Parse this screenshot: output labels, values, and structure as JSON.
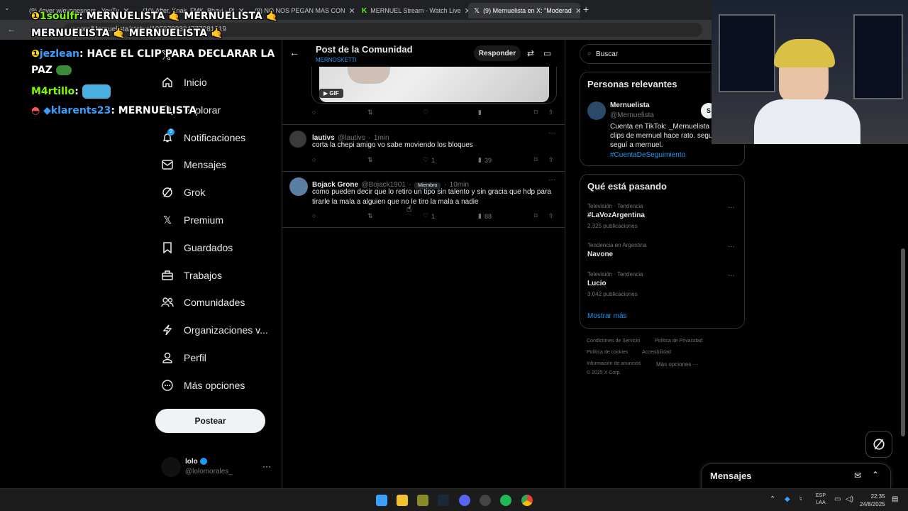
{
  "browser": {
    "tabs": [
      {
        "label": "(9) 4ever w/evanesnom - YouTu",
        "color": "#ff0000"
      },
      {
        "label": "(10) After, Knak, FMK, Bhavi - Pl",
        "color": "#ff0000"
      },
      {
        "label": "(9) NO NOS PEGAN MAS CON",
        "color": "#ff0000"
      },
      {
        "label": "MERNUEL Stream - Watch Live",
        "color": "#53fc18"
      },
      {
        "label": "(9) Mernuelista en X: \"Moderad",
        "color": "#ffffff"
      }
    ],
    "url": "x.com/Mernuelista/status/1959788384777281819"
  },
  "chat": [
    {
      "user": "1soulfr",
      "msg": ": MERNUELISTA",
      "msg2": "MERNUELISTA",
      "user_color": "#7cfc00"
    },
    {
      "user": "",
      "msg": "MERNUELISTA",
      "msg2": "MERNUELISTA",
      "user_color": "#ffffff"
    },
    {
      "user": "jezlean",
      "msg": ": HACE EL CLIP PARA DECLARAR LA",
      "user_color": "#3aa0ff"
    },
    {
      "user": "",
      "msg": "PAZ",
      "user_color": "#ffffff"
    },
    {
      "user": "M4rtillo",
      "msg": ":",
      "user_color": "#7cfc00"
    },
    {
      "user": "klarents23",
      "msg": ": MERNUELISTA",
      "user_color": "#3aa0ff"
    }
  ],
  "nav": {
    "items": [
      "Inicio",
      "Explorar",
      "Notificaciones",
      "Mensajes",
      "Grok",
      "Premium",
      "Guardados",
      "Trabajos",
      "Comunidades",
      "Organizaciones v...",
      "Perfil",
      "Más opciones"
    ],
    "notification_badge": "9",
    "post_button": "Postear",
    "account_name": "lolo",
    "account_handle": "@lolomorales_"
  },
  "main": {
    "title": "Post de la Comunidad",
    "subtitle": "MERNOSKETTI",
    "reply_button": "Responder",
    "gif_label": "GIF",
    "tweets": [
      {
        "name": "lautivs",
        "handle": "@lautivs",
        "time": "1min",
        "text": "corta la chepi amigo vo sabe moviendo los bloques",
        "likes": "1",
        "views": "39"
      },
      {
        "name": "Bojack Grone",
        "handle": "@Bojack1901",
        "badge": "Miembro",
        "time": "10min",
        "text": "como pueden decir que lo retiro un tipo sin talento y sin gracia que hdp para tirarle la mala a alguien que no le tiro la mala a nadie",
        "likes": "1",
        "views": "88"
      }
    ]
  },
  "right": {
    "search_placeholder": "Buscar",
    "relevant_title": "Personas relevantes",
    "person_name": "Mernuelista",
    "person_handle": "@Mernuelista",
    "person_bio": "Cuenta en TikTok: _Mernuelista clips de mernuel hace rato. segui seguí a mernuel.",
    "person_tag": "#CuentaDeSeguimiento",
    "follow_button": "S",
    "trends_title": "Qué está pasando",
    "trends": [
      {
        "context": "Televisión · Tendencia",
        "name": "#LaVozArgentina",
        "count": "2.325 publicaciones"
      },
      {
        "context": "Tendencia en Argentina",
        "name": "Navone",
        "count": ""
      },
      {
        "context": "Televisión · Tendencia",
        "name": "Lucio",
        "count": "3.042 publicaciones"
      }
    ],
    "show_more": "Mostrar más",
    "footer": [
      "Condiciones de Servicio",
      "Política de Privacidad",
      "Política de cookies",
      "Accesibilidad",
      "Información de anuncios",
      "Más opciones ···",
      "© 2025 X Corp."
    ]
  },
  "dm": {
    "title": "Mensajes"
  },
  "taskbar": {
    "lang": "ESP",
    "lang2": "LAA",
    "time": "22:35",
    "date": "24/8/2025"
  }
}
